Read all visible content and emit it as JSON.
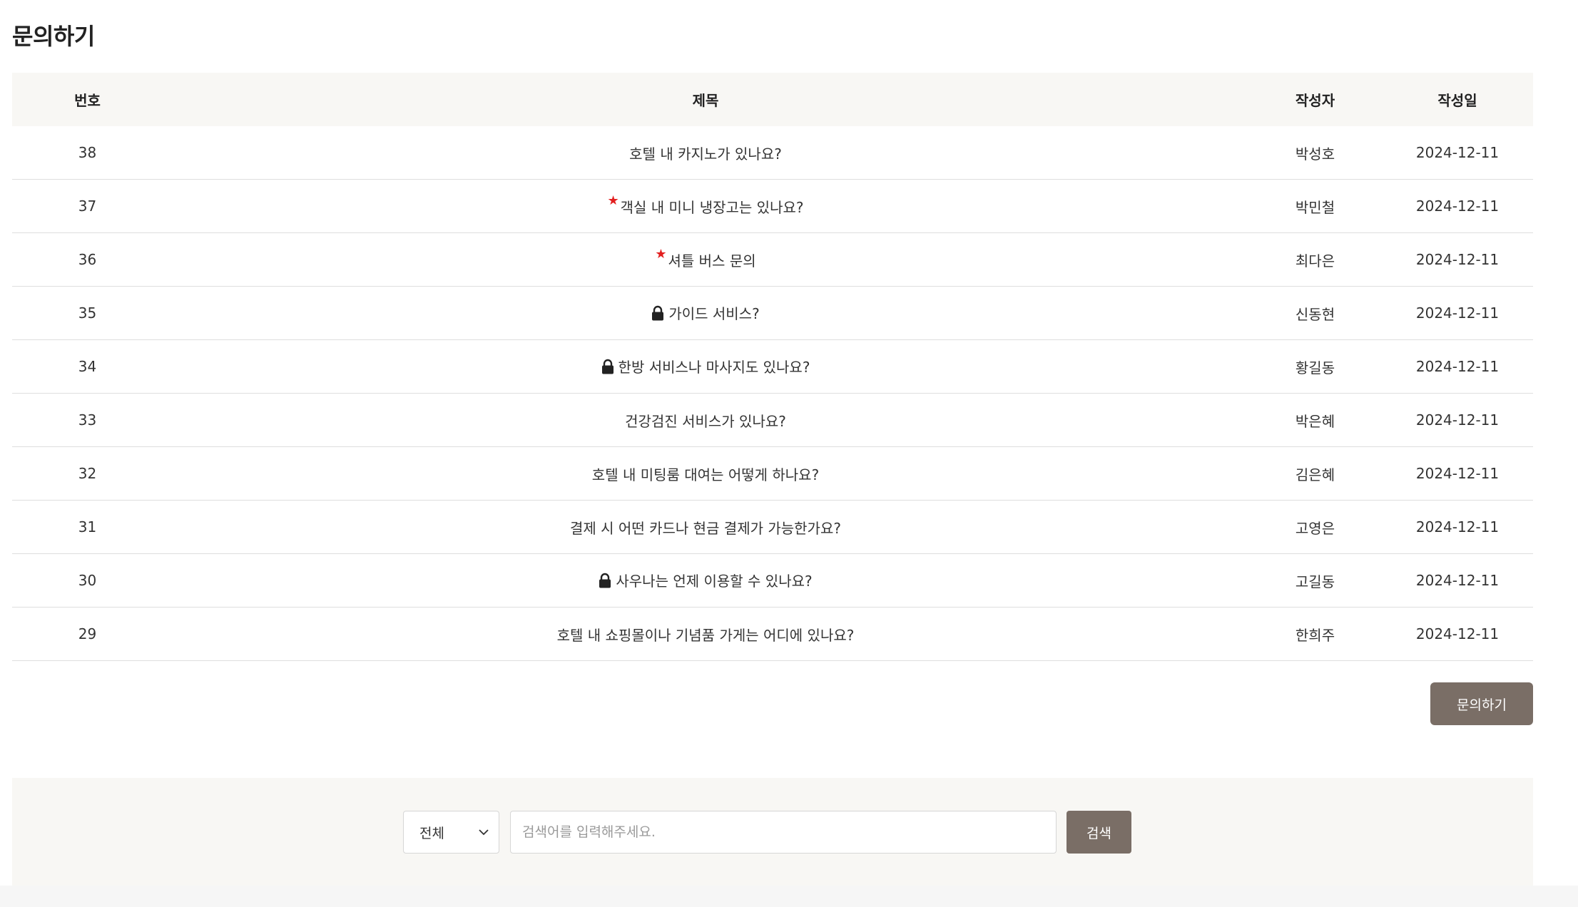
{
  "page": {
    "title": "문의하기"
  },
  "table": {
    "headers": {
      "no": "번호",
      "title": "제목",
      "writer": "작성자",
      "date": "작성일"
    },
    "rows": [
      {
        "no": "38",
        "title": "호텔 내 카지노가 있나요?",
        "writer": "박성호",
        "date": "2024-12-11",
        "star": false,
        "lock": false
      },
      {
        "no": "37",
        "title": "객실 내 미니 냉장고는 있나요?",
        "writer": "박민철",
        "date": "2024-12-11",
        "star": true,
        "lock": false
      },
      {
        "no": "36",
        "title": "셔틀 버스 문의",
        "writer": "최다은",
        "date": "2024-12-11",
        "star": true,
        "lock": false
      },
      {
        "no": "35",
        "title": "가이드 서비스?",
        "writer": "신동현",
        "date": "2024-12-11",
        "star": false,
        "lock": true
      },
      {
        "no": "34",
        "title": "한방 서비스나 마사지도 있나요?",
        "writer": "황길동",
        "date": "2024-12-11",
        "star": false,
        "lock": true
      },
      {
        "no": "33",
        "title": "건강검진 서비스가 있나요?",
        "writer": "박은혜",
        "date": "2024-12-11",
        "star": false,
        "lock": false
      },
      {
        "no": "32",
        "title": "호텔 내 미팅룸 대여는 어떻게 하나요?",
        "writer": "김은혜",
        "date": "2024-12-11",
        "star": false,
        "lock": false
      },
      {
        "no": "31",
        "title": "결제 시 어떤 카드나 현금 결제가 가능한가요?",
        "writer": "고영은",
        "date": "2024-12-11",
        "star": false,
        "lock": false
      },
      {
        "no": "30",
        "title": "사우나는 언제 이용할 수 있나요?",
        "writer": "고길동",
        "date": "2024-12-11",
        "star": false,
        "lock": true
      },
      {
        "no": "29",
        "title": "호텔 내 쇼핑몰이나 기념품 가게는 어디에 있나요?",
        "writer": "한희주",
        "date": "2024-12-11",
        "star": false,
        "lock": false
      }
    ]
  },
  "actions": {
    "write_label": "문의하기"
  },
  "search": {
    "select_value": "전체",
    "placeholder": "검색어를 입력해주세요.",
    "button_label": "검색"
  },
  "icons": {
    "star": "★",
    "lock": "lock-icon",
    "chevron": "chevron-down-icon"
  },
  "colors": {
    "accent": "#7a6e66",
    "star": "#e21f1f",
    "header_bg": "#f8f7f4"
  }
}
